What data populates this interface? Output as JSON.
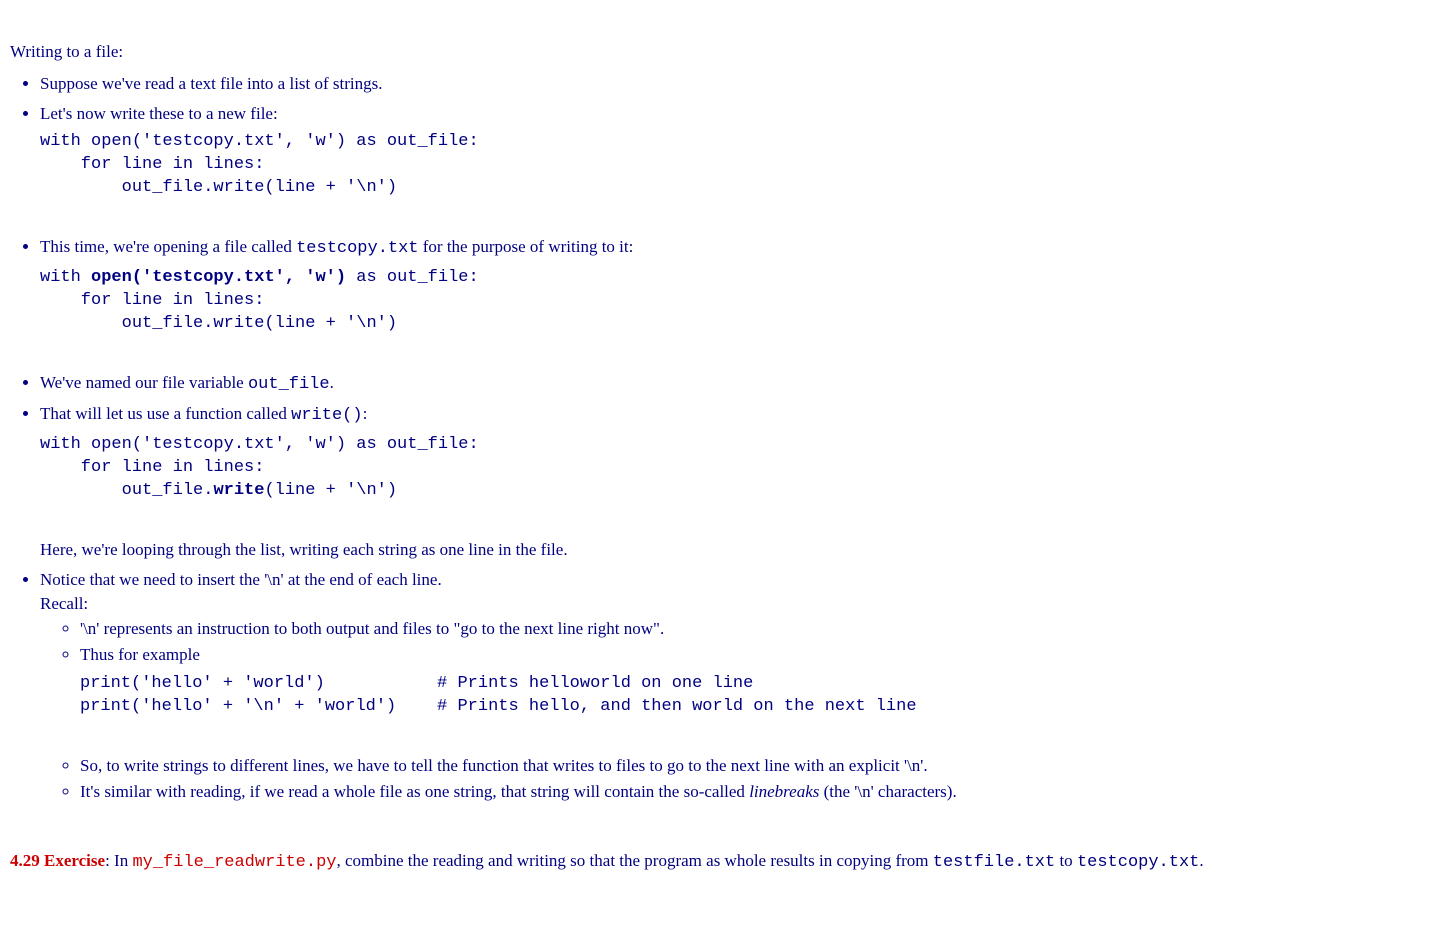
{
  "heading": "Writing to a file:",
  "bullets": {
    "b1": "Suppose we've read a text file into a list of strings.",
    "b2": "Let's now write these to a new file:",
    "b3_pre": "This time, we're opening a file called ",
    "b3_code": "testcopy.txt",
    "b3_post": " for the purpose of writing to it:",
    "b4_pre": "We've named our file variable ",
    "b4_code": "out_file",
    "b4_post": ".",
    "b5_pre": "That will let us use a function called ",
    "b5_code": "write()",
    "b5_post": ":",
    "b5_after": "Here, we're looping through the list, writing each string as one line in the file.",
    "b6_line1": "Notice that we need to insert the '\\n' at the end of each line.",
    "b6_line2": "Recall:"
  },
  "inner": {
    "i1": "'\\n' represents an instruction to both output and files to \"go to the next line right now\".",
    "i2": "Thus for example",
    "i3": "So, to write strings to different lines, we have to tell the function that writes to files to go to the next line with an explicit '\\n'.",
    "i4_pre": "It's similar with reading, if we read a whole file as one string, that string will contain the so-called ",
    "i4_em": "linebreaks",
    "i4_post": " (the '\\n' characters)."
  },
  "code": {
    "c1": "with open('testcopy.txt', 'w') as out_file:\n    for line in lines:\n        out_file.write(line + '\\n')\n    ",
    "c2_a": "with ",
    "c2_b": "open('testcopy.txt', 'w')",
    "c2_c": " as out_file:\n    for line in lines:\n        out_file.write(line + '\\n')\n    ",
    "c3_a": "with open('testcopy.txt', 'w') as out_file:\n    for line in lines:\n        out_file.",
    "c3_b": "write",
    "c3_c": "(line + '\\n')\n    ",
    "c4": "print('hello' + 'world')           # Prints helloworld on one line\nprint('hello' + '\\n' + 'world')    # Prints hello, and then world on the next line\n    "
  },
  "exercise": {
    "label": "4.29 Exercise",
    "pre": ": In ",
    "file": "my_file_readwrite.py",
    "mid": ", combine the reading and writing so that the program as whole results in copying from ",
    "f1": "testfile.txt",
    "to": " to ",
    "f2": "testcopy.txt",
    "end": "."
  }
}
